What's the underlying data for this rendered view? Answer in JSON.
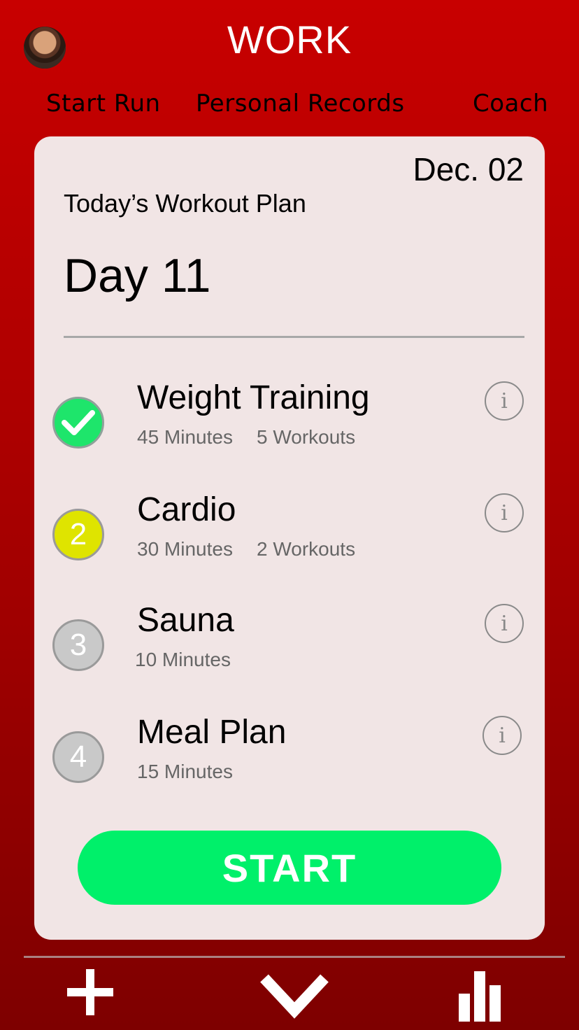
{
  "header": {
    "title": "WORK",
    "avatar_icon": "user-avatar",
    "nav": [
      {
        "label": "Start Run"
      },
      {
        "label": "Personal Records"
      },
      {
        "label": "Coach"
      }
    ]
  },
  "plan": {
    "date": "Dec. 02",
    "title": "Today’s Workout Plan",
    "day": "Day 11",
    "items": [
      {
        "status": "done",
        "marker": "",
        "name": "Weight Training",
        "duration": "45 Minutes",
        "workouts": "5 Workouts"
      },
      {
        "status": "active",
        "marker": "2",
        "name": "Cardio",
        "duration": "30 Minutes",
        "workouts": "2 Workouts"
      },
      {
        "status": "pending",
        "marker": "3",
        "name": "Sauna",
        "duration": "10 Minutes",
        "workouts": ""
      },
      {
        "status": "pending",
        "marker": "4",
        "name": "Meal Plan",
        "duration": "15 Minutes",
        "workouts": ""
      }
    ],
    "start_label": "START"
  },
  "bottom_bar": {
    "icons": [
      "plus-icon",
      "chevron-down-icon",
      "bar-chart-icon"
    ]
  },
  "colors": {
    "background": "#c80000",
    "card": "#f1e5e5",
    "done": "#1ee56b",
    "active": "#dfe400",
    "pending": "#c9c9c9",
    "start_button": "#00f06a"
  }
}
